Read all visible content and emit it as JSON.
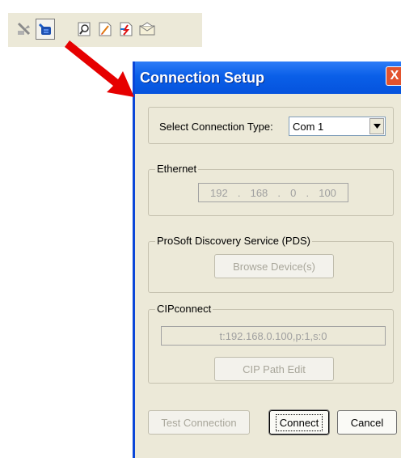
{
  "toolbar": {
    "icons": [
      {
        "name": "disconnect-icon"
      },
      {
        "name": "connect-icon",
        "pressed": true
      },
      {
        "name": "zoom-icon"
      },
      {
        "name": "new-document-icon"
      },
      {
        "name": "import-icon"
      },
      {
        "name": "email-icon"
      }
    ]
  },
  "dialog": {
    "title": "Connection Setup",
    "close_label": "X",
    "select_connection_type_label": "Select Connection Type:",
    "connection_type_value": "Com 1",
    "ethernet": {
      "group_label": "Ethernet",
      "ip_octets": [
        "192",
        "168",
        "0",
        "100"
      ]
    },
    "pds": {
      "group_label": "ProSoft Discovery Service (PDS)",
      "browse_button": "Browse Device(s)"
    },
    "cipconnect": {
      "group_label": "CIPconnect",
      "path_value": "t:192.168.0.100,p:1,s:0",
      "path_edit_button": "CIP Path Edit"
    },
    "buttons": {
      "test_connection": "Test Connection",
      "connect": "Connect",
      "cancel": "Cancel"
    }
  },
  "colors": {
    "titlebar": "#0553dd",
    "dialog_bg": "#ece9d8",
    "arrow": "#e60000"
  }
}
